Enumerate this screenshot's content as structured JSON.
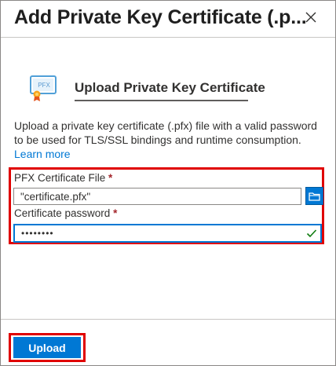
{
  "panel": {
    "title": "Add Private Key Certificate (.p..."
  },
  "header": {
    "heading": "Upload Private Key Certificate",
    "icon": "certificate-icon",
    "icon_badge": "PFX"
  },
  "description": {
    "text": "Upload a private key certificate (.pfx) file with a valid password to be used for TLS/SSL bindings and runtime consumption.",
    "link": "Learn more"
  },
  "form": {
    "file_label": "PFX Certificate File",
    "file_value": "\"certificate.pfx\"",
    "password_label": "Certificate password",
    "password_value": "••••••••",
    "required_marker": "*"
  },
  "footer": {
    "upload_label": "Upload"
  },
  "colors": {
    "accent": "#0078d4",
    "highlight": "#e00000",
    "required": "#a4262c",
    "valid": "#107c10"
  }
}
